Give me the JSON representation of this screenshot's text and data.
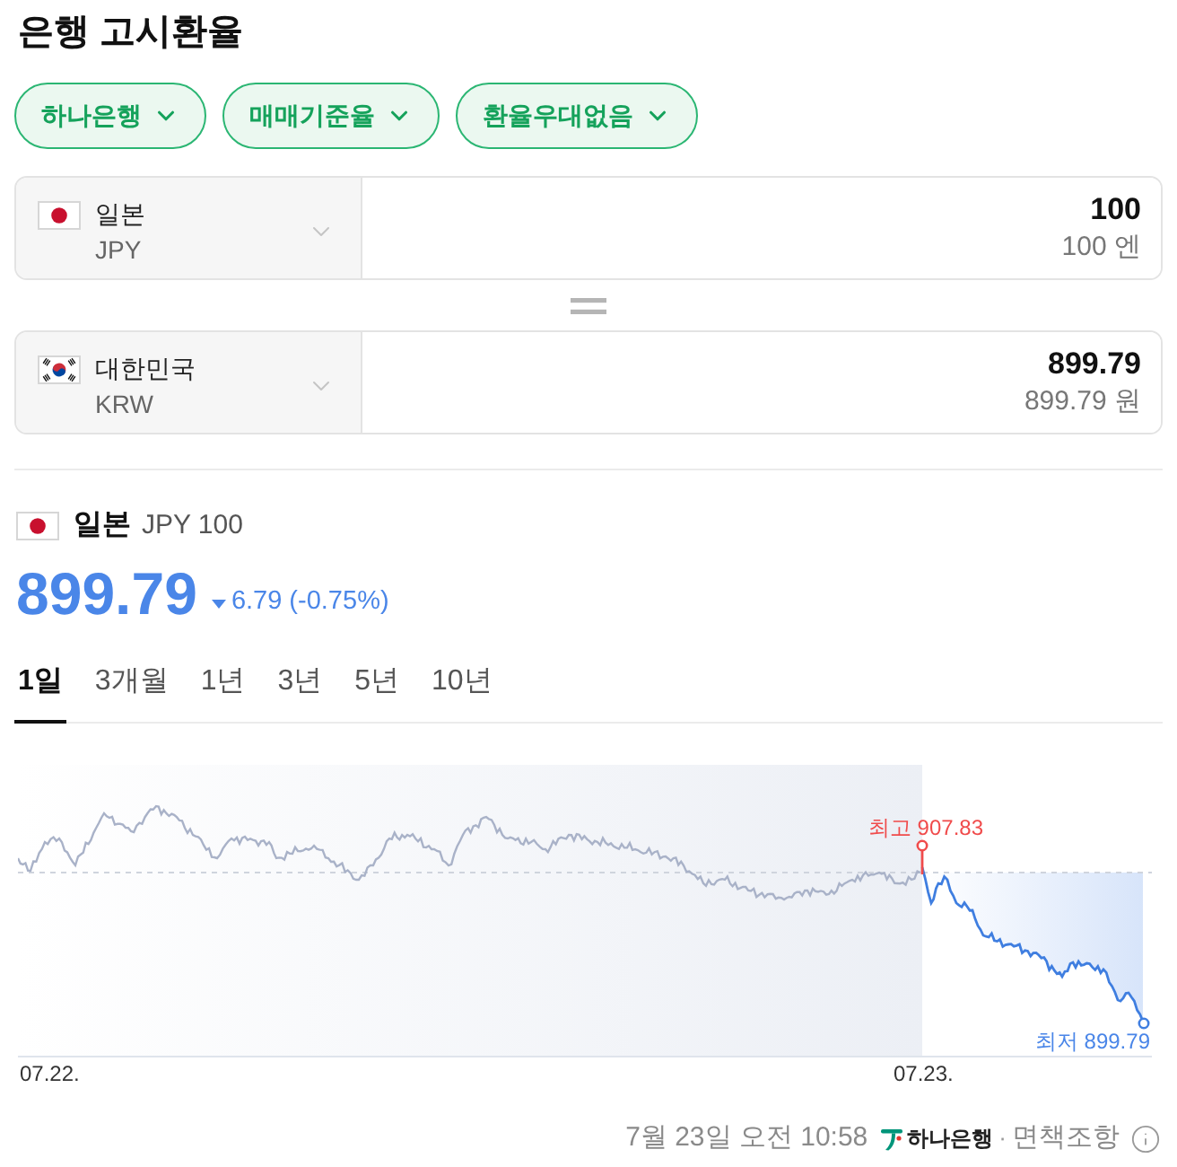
{
  "title": "은행 고시환율",
  "filters": [
    {
      "label": "하나은행"
    },
    {
      "label": "매매기준율"
    },
    {
      "label": "환율우대없음"
    }
  ],
  "converter": [
    {
      "kind": "japan",
      "country": "일본",
      "code": "JPY",
      "amount": "100",
      "amount_words": "100 엔"
    },
    {
      "kind": "korea",
      "country": "대한민국",
      "code": "KRW",
      "amount": "899.79",
      "amount_words": "899.79 원"
    }
  ],
  "quote": {
    "kind": "japan",
    "country": "일본",
    "unit": "JPY 100",
    "price": "899.79",
    "falling": true,
    "change": "6.79 (-0.75%)"
  },
  "tabs": [
    {
      "label": "1일",
      "selected": true
    },
    {
      "label": "3개월",
      "selected": false
    },
    {
      "label": "1년",
      "selected": false
    },
    {
      "label": "3년",
      "selected": false
    },
    {
      "label": "5년",
      "selected": false
    },
    {
      "label": "10년",
      "selected": false
    }
  ],
  "chart": {
    "high_label": "최고 907.83",
    "low_label": "최저 899.79",
    "x_labels": [
      "07.22.",
      "07.23."
    ]
  },
  "footer": {
    "updated": "7월 23일 오전 10:58",
    "bank": "하나은행",
    "separator": "·",
    "disclaimer": "면책조항"
  }
}
